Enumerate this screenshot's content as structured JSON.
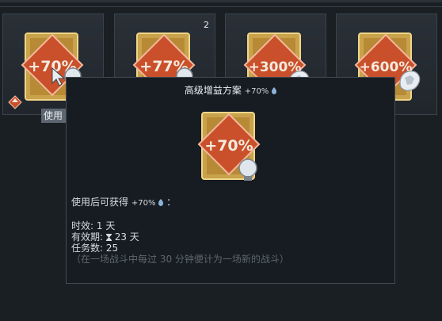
{
  "slots": [
    {
      "badge_text": "+70%",
      "qty": "",
      "has_bulb": true,
      "has_badge": true,
      "emblem": "bulb-icon"
    },
    {
      "badge_text": "+77%",
      "qty": "2",
      "has_bulb": true,
      "has_badge": false,
      "emblem": "bulb-icon"
    },
    {
      "badge_text": "+300%",
      "qty": "",
      "has_bulb": false,
      "has_badge": false,
      "emblem": "lion-emblem-icon"
    },
    {
      "badge_text": "+600%",
      "qty": "",
      "has_bulb": false,
      "has_badge": false,
      "emblem": "lion-emblem-icon"
    }
  ],
  "use_tab_label": "使用",
  "tooltip": {
    "title": "高级增益方案",
    "title_bonus": "+70%",
    "icon_text": "+70%",
    "gain_prefix": "使用后可获得",
    "gain_value": "+70%",
    "gain_suffix": "：",
    "duration_label": "时效:",
    "duration_value": "1 天",
    "validity_label": "有效期:",
    "validity_value": "23 天",
    "missions_label": "任务数:",
    "missions_value": "25",
    "note": "（在一场战斗中每过 30 分钟便计为一场新的战斗）"
  },
  "colors": {
    "card_red": "#c9502b",
    "card_gold": "#d9b45a",
    "bulb": "#dfe6ec",
    "accent_blue": "#8cb3d9"
  }
}
